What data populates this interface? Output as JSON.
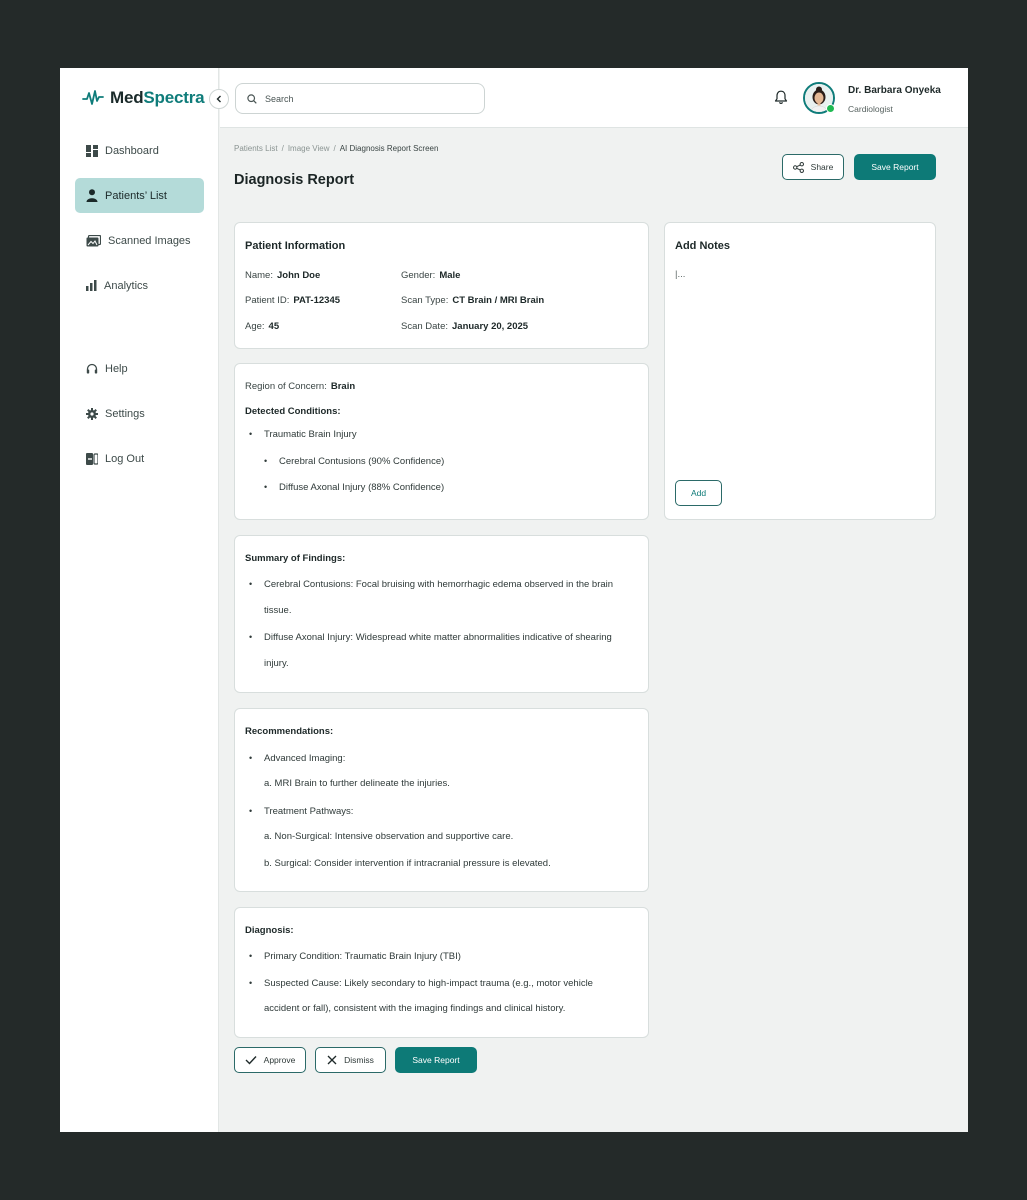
{
  "brand": {
    "name_part1": "Med",
    "name_part2": "Spectra",
    "accent": "#0f7c7a"
  },
  "sidebar": {
    "items": [
      {
        "label": "Dashboard",
        "icon": "dashboard-icon"
      },
      {
        "label": "Patients’ List",
        "icon": "user-icon",
        "active": true
      },
      {
        "label": "Scanned Images",
        "icon": "images-icon"
      },
      {
        "label": "Analytics",
        "icon": "bar-chart-icon"
      }
    ],
    "bottom_items": [
      {
        "label": "Help",
        "icon": "headset-icon"
      },
      {
        "label": "Settings",
        "icon": "gear-icon"
      },
      {
        "label": "Log Out",
        "icon": "logout-icon"
      }
    ]
  },
  "search": {
    "placeholder": "Search"
  },
  "user": {
    "name": "Dr. Barbara Onyeka",
    "role": "Cardiologist",
    "status": "online"
  },
  "breadcrumb": [
    "Patients List",
    "Image View",
    "AI Diagnosis Report Screen"
  ],
  "page": {
    "title": "Diagnosis Report",
    "share_label": "Share",
    "save_label": "Save Report"
  },
  "patient_info": {
    "title": "Patient Information",
    "name_label": "Name:",
    "name": "John Doe",
    "gender_label": "Gender:",
    "gender": "Male",
    "id_label": "Patient ID:",
    "id": "PAT-12345",
    "scan_type_label": "Scan Type:",
    "scan_type": "CT Brain / MRI Brain",
    "age_label": "Age:",
    "age": "45",
    "scan_date_label": "Scan Date:",
    "scan_date": "January 20, 2025"
  },
  "conditions": {
    "region_label": "Region of Concern:",
    "region": "Brain",
    "detected_label": "Detected Conditions:",
    "primary": "Traumatic Brain Injury",
    "sub": [
      "Cerebral Contusions (90% Confidence)",
      "Diffuse Axonal Injury (88% Confidence)"
    ]
  },
  "summary": {
    "title": "Summary of Findings:",
    "items": [
      {
        "line1": "Cerebral Contusions: Focal bruising with hemorrhagic edema observed in the brain",
        "line2": "tissue."
      },
      {
        "line1": "Diffuse Axonal Injury: Widespread white matter abnormalities indicative of shearing",
        "line2": "injury."
      }
    ]
  },
  "recommendations": {
    "title": "Recommendations:",
    "advanced": "Advanced Imaging:",
    "advanced_a": "a. MRI Brain to further delineate the injuries.",
    "treatment": "Treatment Pathways:",
    "treatment_a": "a. Non-Surgical: Intensive observation and supportive care.",
    "treatment_b": "b. Surgical: Consider intervention if intracranial pressure is elevated."
  },
  "diagnosis": {
    "title": "Diagnosis:",
    "primary": "Primary Condition: Traumatic Brain Injury (TBI)",
    "cause_line1": "Suspected Cause: Likely secondary to high-impact trauma (e.g., motor vehicle",
    "cause_line2": "accident or fall), consistent with the imaging findings and clinical history."
  },
  "actions": {
    "approve": "Approve",
    "dismiss": "Dismiss",
    "save": "Save Report"
  },
  "notes": {
    "title": "Add Notes",
    "value": "|...",
    "add_label": "Add"
  }
}
